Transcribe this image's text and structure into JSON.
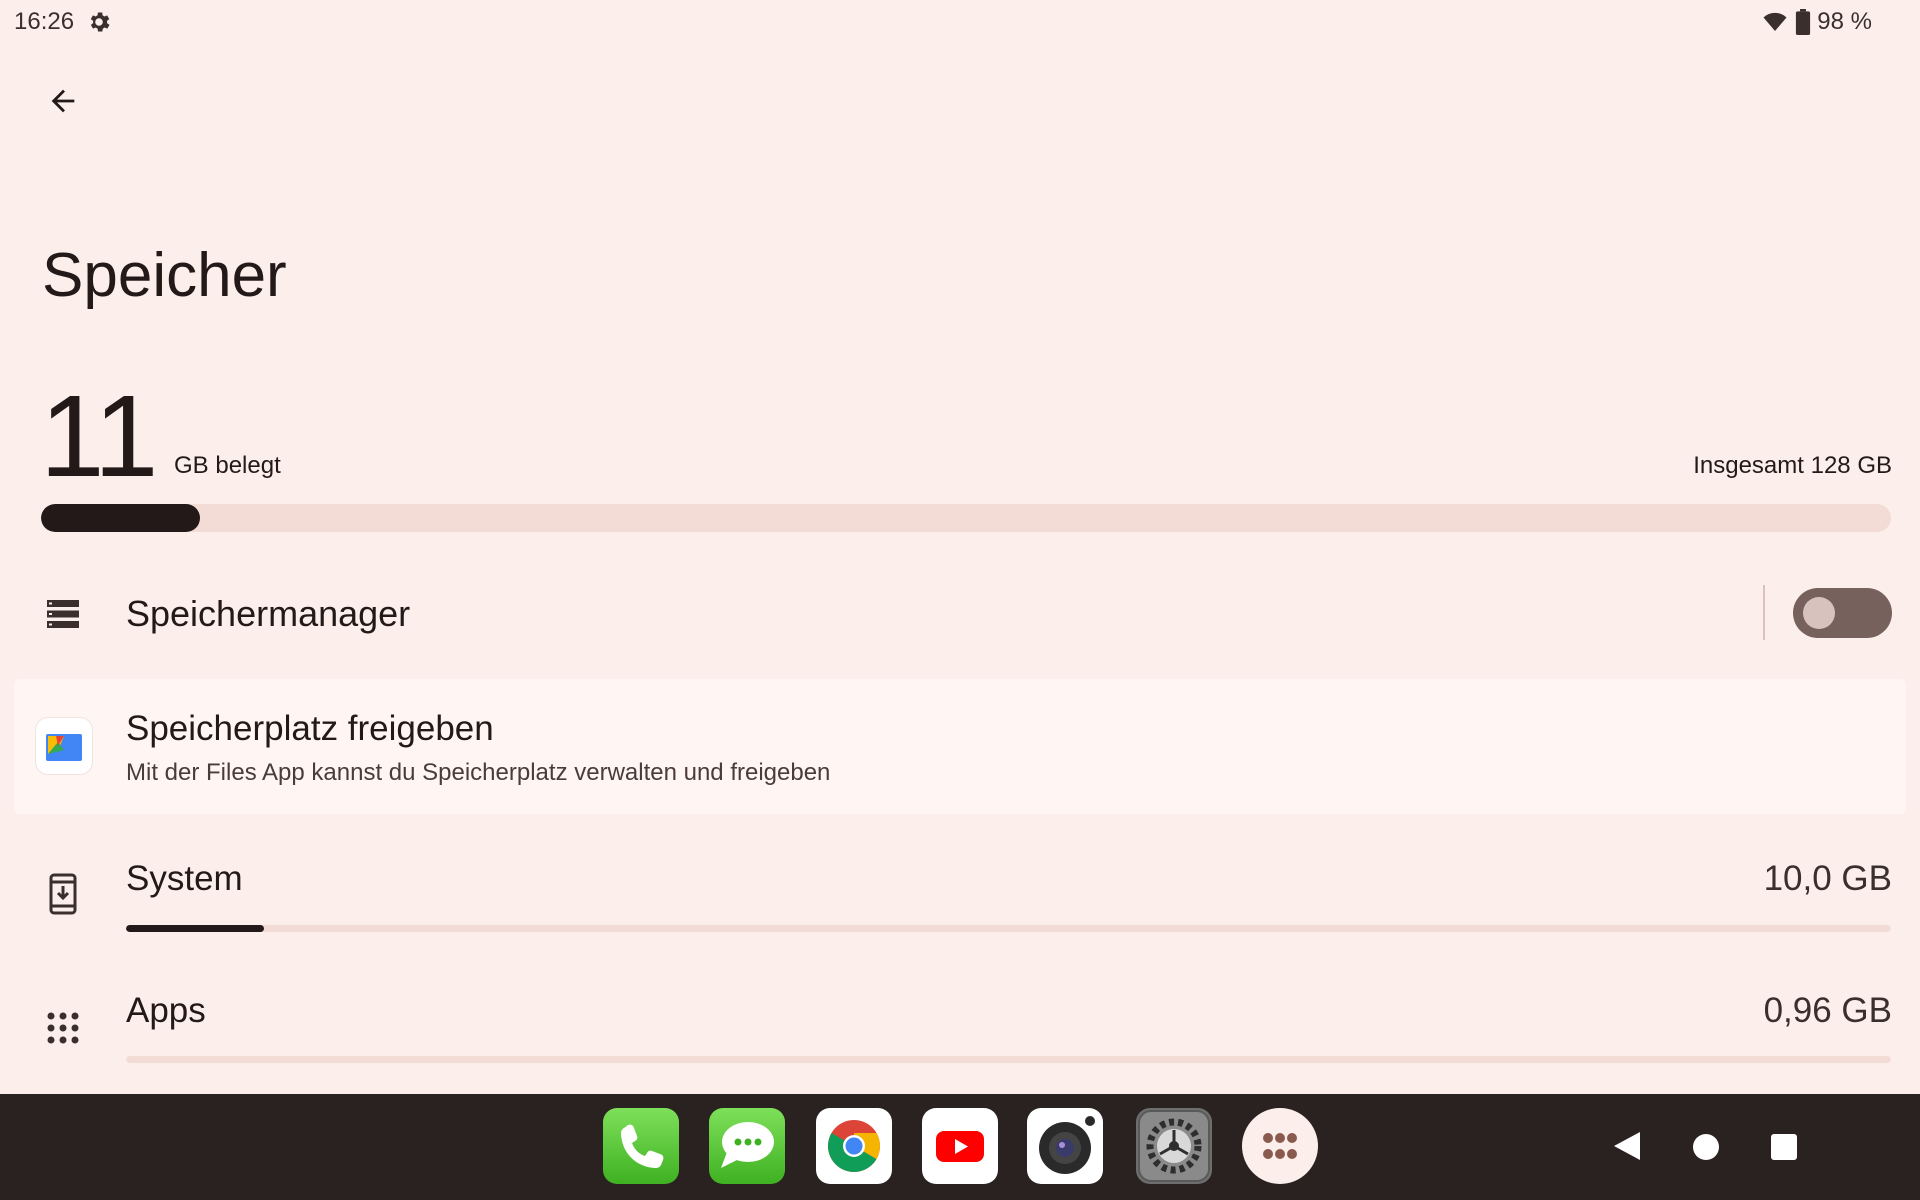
{
  "status_bar": {
    "time": "16:26",
    "battery": "98 %",
    "icons": [
      "settings-gear-icon",
      "wifi-icon",
      "battery-icon"
    ]
  },
  "page": {
    "title": "Speicher"
  },
  "storage_summary": {
    "used_value": "11",
    "used_unit": "GB belegt",
    "total_label": "Insgesamt 128 GB",
    "used_fraction": 0.086
  },
  "storage_manager": {
    "label": "Speichermanager",
    "enabled": false,
    "icon": "storage-manager-icon"
  },
  "free_up": {
    "title": "Speicherplatz freigeben",
    "subtitle": "Mit der Files App kannst du Speicherplatz verwalten und freigeben",
    "icon": "files-app-icon"
  },
  "categories": [
    {
      "label": "System",
      "value": "10,0 GB",
      "fraction": 0.078,
      "icon": "system-update-icon"
    },
    {
      "label": "Apps",
      "value": "0,96 GB",
      "fraction": 0.0,
      "icon": "apps-grid-icon"
    }
  ],
  "taskbar": {
    "apps": [
      "phone-app-icon",
      "messages-app-icon",
      "chrome-app-icon",
      "youtube-app-icon",
      "camera-app-icon",
      "settings-app-icon",
      "all-apps-icon"
    ],
    "nav": [
      "back-nav-icon",
      "home-nav-icon",
      "recents-nav-icon"
    ]
  },
  "colors": {
    "background": "#fcefeb",
    "track": "#f4dcd6",
    "fill": "#231918",
    "toggle_off": "#77615d",
    "taskbar": "#2a2221"
  }
}
